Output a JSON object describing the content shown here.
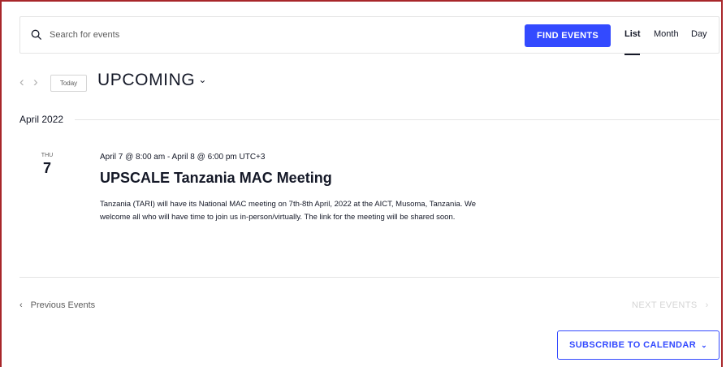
{
  "search": {
    "placeholder": "Search for events",
    "button_label": "FIND EVENTS"
  },
  "views": [
    {
      "label": "List",
      "active": true
    },
    {
      "label": "Month",
      "active": false
    },
    {
      "label": "Day",
      "active": false
    }
  ],
  "nav": {
    "today_label": "Today",
    "range_label": "UPCOMING"
  },
  "month_separator": "April 2022",
  "event": {
    "day_of_week": "THU",
    "day_number": "7",
    "datetime": "April 7 @ 8:00 am - April 8 @ 6:00 pm UTC+3",
    "title": "UPSCALE Tanzania MAC Meeting",
    "description": "Tanzania (TARI) will have its National MAC meeting on 7th-8th April, 2022 at the AICT, Musoma, Tanzania. We welcome all who will have time to join us in-person/virtually. The link for the meeting will be shared soon."
  },
  "pagination": {
    "previous_label": "Previous Events",
    "next_label": "NEXT EVENTS"
  },
  "subscribe_label": "SUBSCRIBE TO CALENDAR",
  "colors": {
    "accent": "#334aff",
    "text": "#141827",
    "muted": "#5d5d5d",
    "frame": "#a8262a"
  }
}
